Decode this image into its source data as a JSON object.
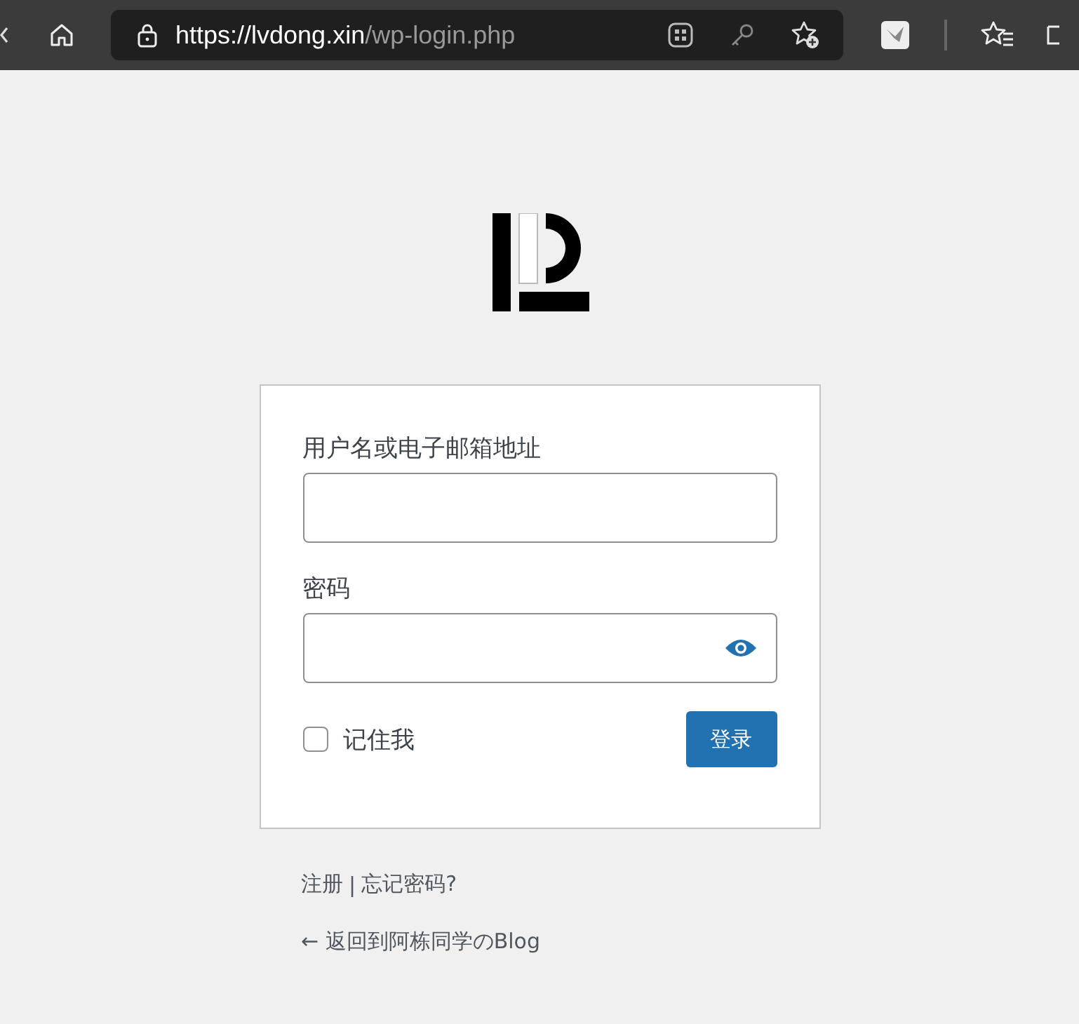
{
  "browser": {
    "url_scheme": "https://",
    "url_host": "lvdong.xin",
    "url_path": "/wp-login.php"
  },
  "form": {
    "username_label": "用户名或电子邮箱地址",
    "password_label": "密码",
    "remember": {
      "label": "记住我",
      "checked": false
    },
    "submit": "登录"
  },
  "links": {
    "register": "注册",
    "separator": "|",
    "lost_password": "忘记密码?",
    "back": "← 返回到阿栋同学のBlog"
  }
}
